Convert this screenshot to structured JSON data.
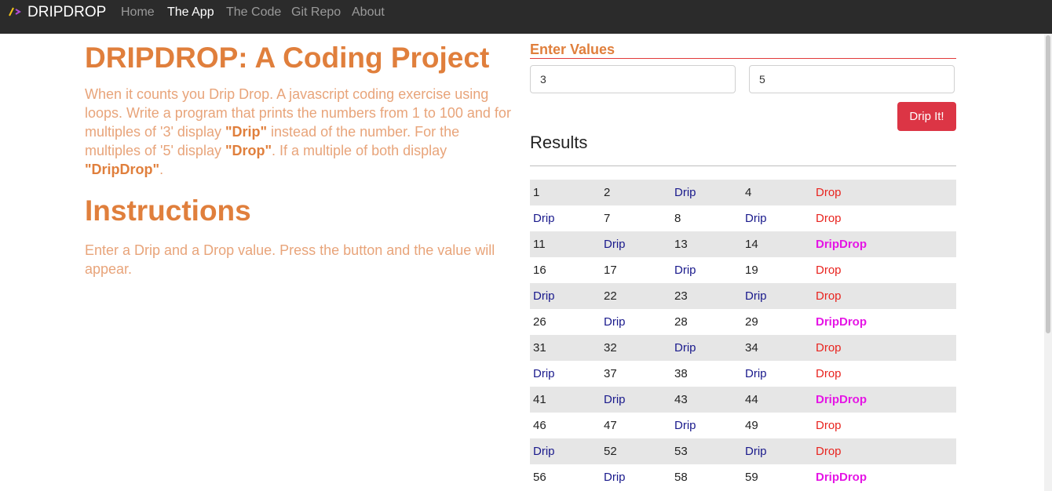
{
  "nav": {
    "brand": "DRIPDROP",
    "links": [
      "Home",
      "The App",
      "The Code",
      "Git Repo",
      "About"
    ]
  },
  "main": {
    "title": "DRIPDROP: A Coding Project",
    "intro_before_drip": "When it counts you Drip Drop. A javascript coding exercise using loops. Write a program that prints the numbers from 1 to 100 and for multiples of '3' display ",
    "intro_drip": "\"Drip\"",
    "intro_mid": " instead of the number. For the multiples of '5' display ",
    "intro_drop": "\"Drop\"",
    "intro_mid2": ". If a multiple of both display ",
    "intro_dripdrop": "\"DripDrop\"",
    "intro_end": ".",
    "instructions_title": "Instructions",
    "instructions_text": "Enter a Drip and a Drop value. Press the button and the value will appear."
  },
  "form": {
    "title": "Enter Values",
    "start_value": "3",
    "end_value": "5",
    "button_label": "Drip It!"
  },
  "results": {
    "title": "Results",
    "rows": [
      [
        "1",
        "2",
        "Drip",
        "4",
        "Drop"
      ],
      [
        "Drip",
        "7",
        "8",
        "Drip",
        "Drop"
      ],
      [
        "11",
        "Drip",
        "13",
        "14",
        "DripDrop"
      ],
      [
        "16",
        "17",
        "Drip",
        "19",
        "Drop"
      ],
      [
        "Drip",
        "22",
        "23",
        "Drip",
        "Drop"
      ],
      [
        "26",
        "Drip",
        "28",
        "29",
        "DripDrop"
      ],
      [
        "31",
        "32",
        "Drip",
        "34",
        "Drop"
      ],
      [
        "Drip",
        "37",
        "38",
        "Drip",
        "Drop"
      ],
      [
        "41",
        "Drip",
        "43",
        "44",
        "DripDrop"
      ],
      [
        "46",
        "47",
        "Drip",
        "49",
        "Drop"
      ],
      [
        "Drip",
        "52",
        "53",
        "Drip",
        "Drop"
      ],
      [
        "56",
        "Drip",
        "58",
        "59",
        "DripDrop"
      ]
    ]
  },
  "colors": {
    "navbar": "#2b2b2b",
    "heading": "#e07f3c",
    "body_text": "#e8a47a",
    "button": "#dc3545",
    "drip": "#1a1a8c",
    "drop": "#e8241f",
    "dripdrop": "#e516e5"
  }
}
